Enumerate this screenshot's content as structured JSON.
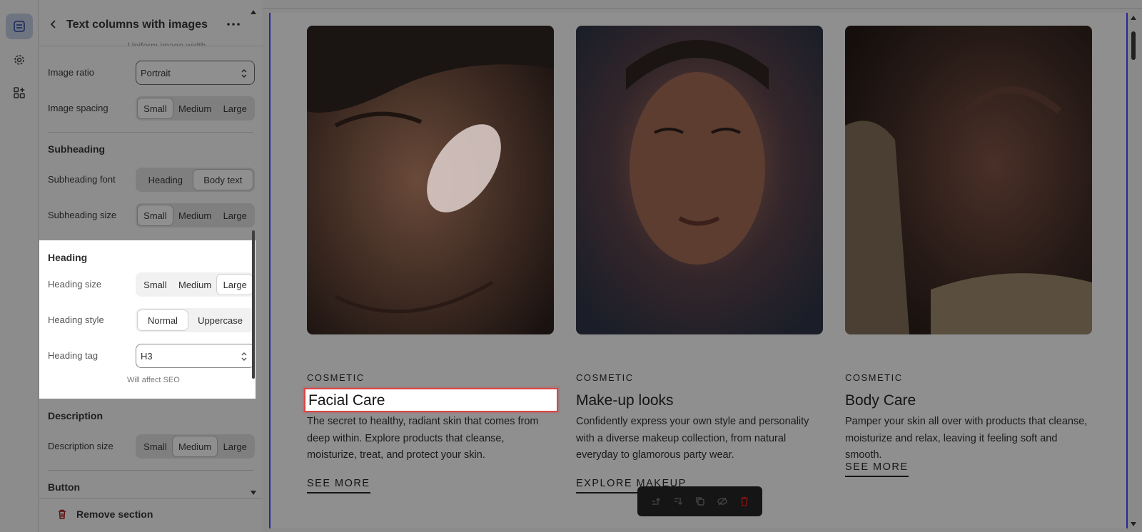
{
  "rail": {
    "items": [
      {
        "icon": "sections-icon",
        "active": true
      },
      {
        "icon": "gear-icon",
        "active": false
      },
      {
        "icon": "apps-icon",
        "active": false
      }
    ]
  },
  "panel": {
    "title": "Text columns with images",
    "cut_text": "Uniform image width",
    "image_ratio": {
      "label": "Image ratio",
      "value": "Portrait"
    },
    "image_spacing": {
      "label": "Image spacing",
      "options": [
        "Small",
        "Medium",
        "Large"
      ],
      "selected": "Small"
    },
    "subheading": {
      "title": "Subheading",
      "font": {
        "label": "Subheading font",
        "options": [
          "Heading",
          "Body text"
        ],
        "selected": "Body text"
      },
      "size": {
        "label": "Subheading size",
        "options": [
          "Small",
          "Medium",
          "Large"
        ],
        "selected": "Small"
      }
    },
    "heading": {
      "title": "Heading",
      "size": {
        "label": "Heading size",
        "options": [
          "Small",
          "Medium",
          "Large"
        ],
        "selected": "Large"
      },
      "style": {
        "label": "Heading style",
        "options": [
          "Normal",
          "Uppercase"
        ],
        "selected": "Normal"
      },
      "tag": {
        "label": "Heading tag",
        "value": "H3",
        "hint": "Will affect SEO"
      }
    },
    "description": {
      "title": "Description",
      "size": {
        "label": "Description size",
        "options": [
          "Small",
          "Medium",
          "Large"
        ],
        "selected": "Medium"
      }
    },
    "button": {
      "title": "Button"
    },
    "remove_label": "Remove section"
  },
  "preview": {
    "columns": [
      {
        "kicker": "COSMETIC",
        "title": "Facial Care",
        "desc": "The secret to healthy, radiant skin that comes from deep within. Explore products that cleanse, moisturize, treat, and protect your skin.",
        "link": "SEE MORE",
        "selected": true
      },
      {
        "kicker": "COSMETIC",
        "title": "Make-up looks",
        "desc": "Confidently express your own style and personality with a diverse makeup collection, from natural everyday to glamorous party wear.",
        "link": "EXPLORE MAKEUP",
        "selected": false
      },
      {
        "kicker": "COSMETIC",
        "title": "Body Care",
        "desc": "Pamper your skin all over with products that cleanse, moisturize and relax, leaving it feeling soft and smooth.",
        "link": "SEE MORE",
        "selected": false
      }
    ]
  },
  "toolbar": {
    "icons": [
      "move-up-icon",
      "move-down-icon",
      "duplicate-icon",
      "hide-icon",
      "delete-icon"
    ]
  }
}
